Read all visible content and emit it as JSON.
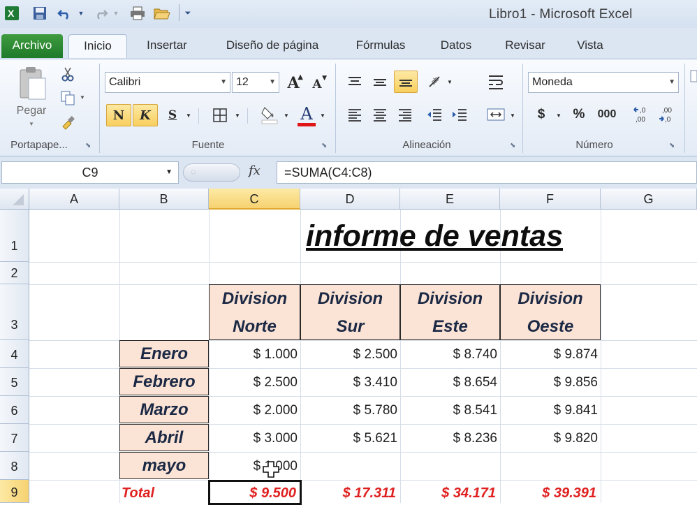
{
  "window": {
    "title": "Libro1  -  Microsoft Excel"
  },
  "tabs": [
    "Archivo",
    "Inicio",
    "Insertar",
    "Diseño de página",
    "Fórmulas",
    "Datos",
    "Revisar",
    "Vista"
  ],
  "ribbon": {
    "clipboard": {
      "paste_label": "Pegar",
      "group_label": "Portapape..."
    },
    "font": {
      "name": "Calibri",
      "size": "12",
      "bold": "N",
      "italic": "K",
      "underline": "S",
      "grow": "A",
      "shrink": "A",
      "color_letter": "A",
      "group_label": "Fuente"
    },
    "alignment": {
      "group_label": "Alineación"
    },
    "number": {
      "format": "Moneda",
      "currency": "$",
      "percent": "%",
      "thousands": "000",
      "group_label": "Número"
    }
  },
  "formula_bar": {
    "name_box": "C9",
    "fx": "fx",
    "formula": "=SUMA(C4:C8)"
  },
  "sheet": {
    "columns": [
      "A",
      "B",
      "C",
      "D",
      "E",
      "F",
      "G"
    ],
    "rows": [
      "1",
      "2",
      "3",
      "4",
      "5",
      "6",
      "7",
      "8",
      "9"
    ],
    "title": "informe de ventas",
    "headers": [
      {
        "l1": "Division",
        "l2": "Norte"
      },
      {
        "l1": "Division",
        "l2": "Sur"
      },
      {
        "l1": "Division",
        "l2": "Este"
      },
      {
        "l1": "Division",
        "l2": "Oeste"
      }
    ],
    "months": [
      "Enero",
      "Febrero",
      "Marzo",
      "Abril",
      "mayo"
    ],
    "values": [
      [
        "$ 1.000",
        "$ 2.500",
        "$ 8.740",
        "$ 9.874"
      ],
      [
        "$ 2.500",
        "$ 3.410",
        "$ 8.654",
        "$ 9.856"
      ],
      [
        "$ 2.000",
        "$ 5.780",
        "$ 8.541",
        "$ 9.841"
      ],
      [
        "$ 3.000",
        "$ 5.621",
        "$ 8.236",
        "$ 9.820"
      ],
      [
        "$ 1.000",
        "",
        "",
        ""
      ]
    ],
    "total_label": "Total",
    "totals": [
      "$ 9.500",
      "$ 17.311",
      "$ 34.171",
      "$ 39.391"
    ]
  },
  "colors": {
    "header_fill": "#fbe3d5",
    "total_text": "#e02020",
    "selected_header": "#f6d271"
  }
}
